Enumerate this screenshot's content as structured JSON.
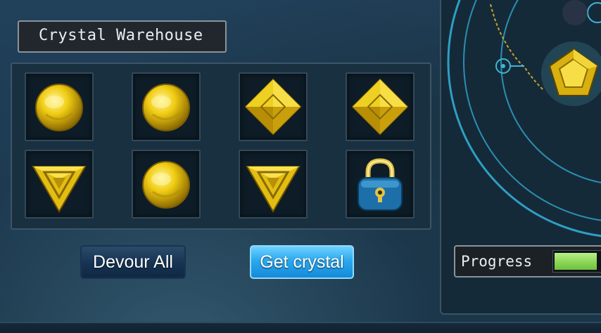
{
  "warehouse": {
    "title": "Crystal Warehouse",
    "slots": [
      {
        "item": "round-gold-crystal"
      },
      {
        "item": "round-gold-crystal"
      },
      {
        "item": "diamond-gold-crystal"
      },
      {
        "item": "diamond-gold-crystal"
      },
      {
        "item": "triangle-gold-crystal"
      },
      {
        "item": "round-gold-crystal"
      },
      {
        "item": "triangle-gold-crystal"
      },
      {
        "item": "lock-icon"
      }
    ]
  },
  "buttons": {
    "devour_all": "Devour All",
    "get_crystal": "Get crystal"
  },
  "progress": {
    "label": "Progress"
  },
  "colors": {
    "gold": "#f2cf1a",
    "gold_dark": "#a57e06",
    "cyan_ring": "#3fb6d6",
    "button_blue": "#2ba8ef"
  }
}
